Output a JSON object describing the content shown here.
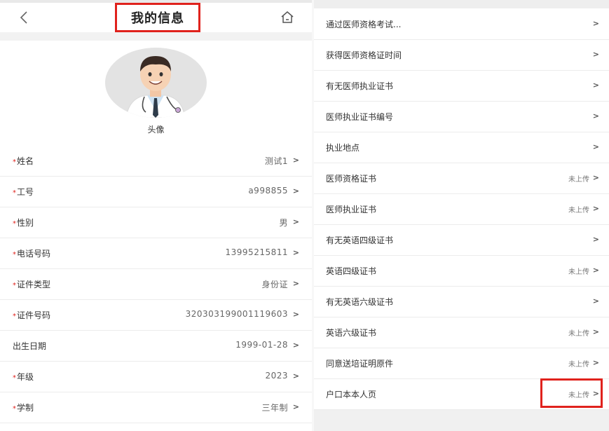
{
  "header": {
    "title": "我的信息",
    "back_icon": "chevron-left-icon",
    "home_icon": "home-icon"
  },
  "avatar": {
    "label": "头像"
  },
  "left_rows": [
    {
      "label": "姓名",
      "required": true,
      "value": "测试1"
    },
    {
      "label": "工号",
      "required": true,
      "value": "a998855"
    },
    {
      "label": "性别",
      "required": true,
      "value": "男"
    },
    {
      "label": "电话号码",
      "required": true,
      "value": "13995215811"
    },
    {
      "label": "证件类型",
      "required": true,
      "value": "身份证"
    },
    {
      "label": "证件号码",
      "required": true,
      "value": "320303199001119603"
    },
    {
      "label": "出生日期",
      "required": false,
      "value": "1999-01-28"
    },
    {
      "label": "年级",
      "required": true,
      "value": "2023"
    },
    {
      "label": "学制",
      "required": true,
      "value": "三年制"
    }
  ],
  "right_rows": [
    {
      "label": "通过医师资格考试...",
      "status": ""
    },
    {
      "label": "获得医师资格证时间",
      "status": ""
    },
    {
      "label": "有无医师执业证书",
      "status": ""
    },
    {
      "label": "医师执业证书编号",
      "status": ""
    },
    {
      "label": "执业地点",
      "status": ""
    },
    {
      "label": "医师资格证书",
      "status": "未上传"
    },
    {
      "label": "医师执业证书",
      "status": "未上传"
    },
    {
      "label": "有无英语四级证书",
      "status": ""
    },
    {
      "label": "英语四级证书",
      "status": "未上传"
    },
    {
      "label": "有无英语六级证书",
      "status": ""
    },
    {
      "label": "英语六级证书",
      "status": "未上传"
    },
    {
      "label": "同意送培证明原件",
      "status": "未上传"
    },
    {
      "label": "户口本本人页",
      "status": "未上传"
    }
  ],
  "required_mark": "*",
  "chevron_glyph": ">",
  "colors": {
    "highlight": "#e0221d",
    "required": "#e0221d"
  }
}
